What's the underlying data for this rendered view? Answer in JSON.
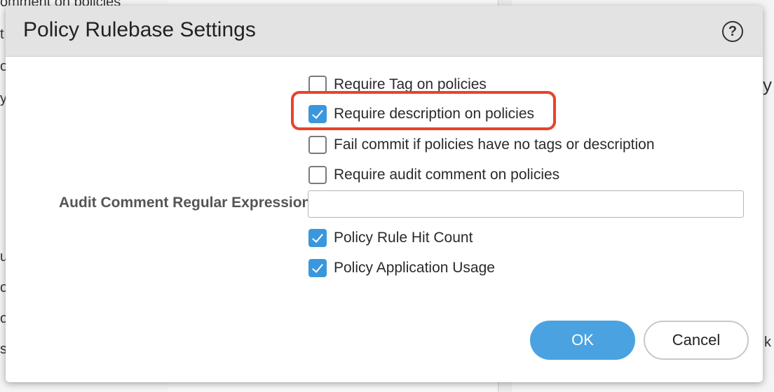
{
  "background": {
    "fragments": [
      "omment on policies",
      "t",
      "o",
      "y",
      "us",
      "o",
      "ov",
      "se",
      "y",
      "k"
    ]
  },
  "dialog": {
    "title": "Policy Rulebase Settings",
    "help_icon": "question-circle-icon",
    "options": [
      {
        "label": "Require Tag on policies",
        "checked": false
      },
      {
        "label": "Require description on policies",
        "checked": true,
        "highlighted": true
      },
      {
        "label": "Fail commit if policies have no tags or description",
        "checked": false
      },
      {
        "label": "Require audit comment on policies",
        "checked": false
      }
    ],
    "audit_regex": {
      "label": "Audit Comment Regular Expression",
      "value": "",
      "placeholder": ""
    },
    "extra_options": [
      {
        "label": "Policy Rule Hit Count",
        "checked": true
      },
      {
        "label": "Policy Application Usage",
        "checked": true
      }
    ],
    "buttons": {
      "ok": "OK",
      "cancel": "Cancel"
    }
  },
  "colors": {
    "accent": "#3b97dd",
    "ok_button": "#4aa3e0",
    "highlight": "#e8432a"
  }
}
